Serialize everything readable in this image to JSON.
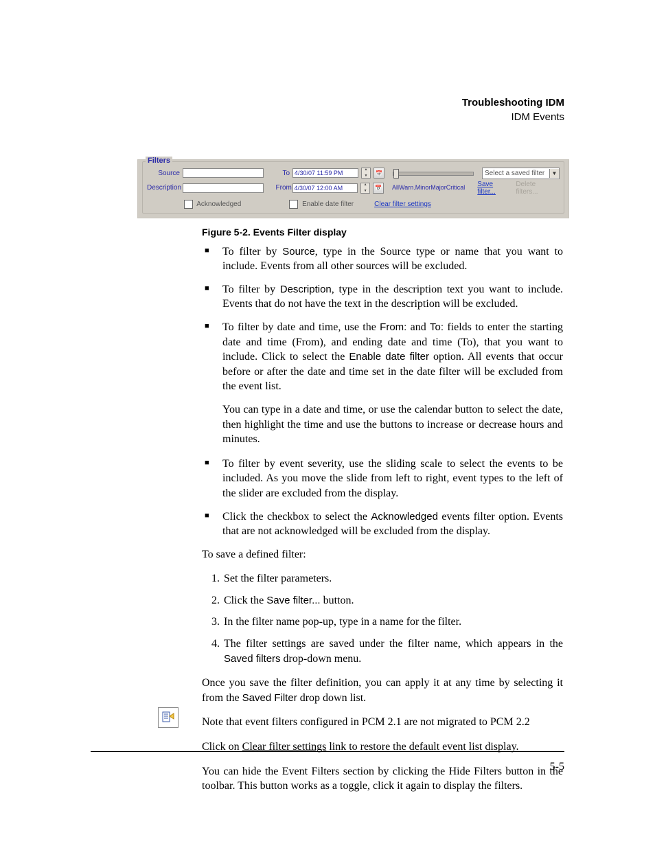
{
  "header": {
    "title_bold": "Troubleshooting IDM",
    "subtitle": "IDM Events"
  },
  "filters_panel": {
    "legend": "Filters",
    "source_label": "Source",
    "source_value": "",
    "description_label": "Description",
    "description_value": "",
    "to_label": "To",
    "to_value": "4/30/07 11:59 PM",
    "from_label": "From",
    "from_value": "4/30/07 12:00 AM",
    "severity_ticks": [
      "All",
      "Warn.",
      "Minor",
      "Major",
      "Critical"
    ],
    "saved_filter_placeholder": "Select a saved filter",
    "save_filter_link": "Save filter...",
    "delete_filters_link": "Delete filters...",
    "acknowledged_label": "Acknowledged",
    "enable_date_label": "Enable date filter",
    "clear_link": "Clear filter settings"
  },
  "figure_caption": "Figure 5-2. Events Filter display",
  "bullets": {
    "b1_pre": "To filter by ",
    "b1_term": "Source",
    "b1_post": ", type in the Source type or name that you want to include. Events from all other sources will be excluded.",
    "b2_pre": "To filter by ",
    "b2_term": "Description",
    "b2_post": ", type in the description text you want to include. Events that do not have the text in the description will be excluded.",
    "b3_pre": "To filter by date and time, use the ",
    "b3_from": "From:",
    "b3_mid1": " and ",
    "b3_to": "To:",
    "b3_mid2": " fields to enter the starting date and time (From), and ending date and time (To), that you want to include. Click to select the ",
    "b3_enable": "Enable date filter",
    "b3_post": " option. All events that occur before or after the date and time set in the date filter will be excluded from the event list.",
    "b3_para2": "You can type in a date and time, or use the calendar button to select the date, then highlight the time and use the buttons to increase or decrease hours and minutes.",
    "b4": "To filter by event severity, use the sliding scale to select the events to be included. As you move the slide from left to right, event types to the left of the slider are excluded from the display.",
    "b5_pre": "Click the checkbox to select the ",
    "b5_term": "Acknowledged",
    "b5_post": " events filter option. Events that are not acknowledged will be excluded from the display."
  },
  "save_intro": "To save a defined filter:",
  "steps": {
    "s1": "Set the filter parameters.",
    "s2_pre": "Click the ",
    "s2_term": "Save filter...",
    "s2_post": " button.",
    "s3": "In the filter name pop-up, type in a name for the filter.",
    "s4_pre": "The filter settings are saved under the filter name, which appears in the ",
    "s4_term": "Saved filters",
    "s4_post": " drop-down menu."
  },
  "apply_para_pre": "Once you save the filter definition, you can apply it at any time by selecting it from the ",
  "apply_para_term": "Saved Filter",
  "apply_para_post": " drop down list.",
  "note_para": "Note that event filters configured in PCM 2.1 are not migrated to PCM 2.2",
  "clear_para_pre": "Click on ",
  "clear_para_link": "Clear filter settings",
  "clear_para_post": " link to restore the default event list display.",
  "hide_para": "You can hide the Event Filters section by clicking the Hide Filters button in the toolbar. This button works as a toggle, click it again to display the filters.",
  "page_number": "5-5"
}
